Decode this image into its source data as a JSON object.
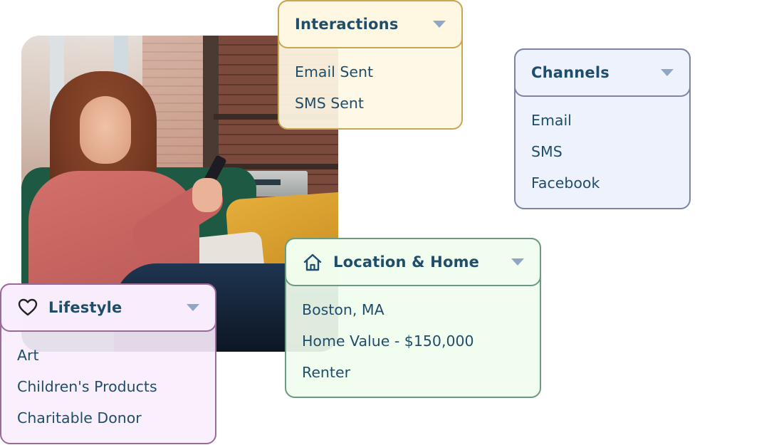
{
  "photo": {
    "description": "Woman on a green sofa smiling at her smartphone"
  },
  "cards": {
    "interactions": {
      "title": "Interactions",
      "icon": "none",
      "items": [
        "Email Sent",
        "SMS Sent"
      ],
      "accent": "#c9a650",
      "background": "#fef8e4"
    },
    "channels": {
      "title": "Channels",
      "icon": "none",
      "items": [
        "Email",
        "SMS",
        "Facebook"
      ],
      "accent": "#7e83a8",
      "background": "#eef2fd"
    },
    "location": {
      "title": "Location & Home",
      "icon": "home-icon",
      "items": [
        "Boston, MA",
        "Home Value - $150,000",
        "Renter"
      ],
      "accent": "#6a9b80",
      "background": "#f0fded"
    },
    "lifestyle": {
      "title": "Lifestyle",
      "icon": "heart-icon",
      "items": [
        "Art",
        "Children's Products",
        "Charitable Donor"
      ],
      "accent": "#9b6b98",
      "background": "#f9edfd"
    }
  },
  "colors": {
    "text": "#1f4e6b",
    "caret": "#8fa6c6"
  }
}
